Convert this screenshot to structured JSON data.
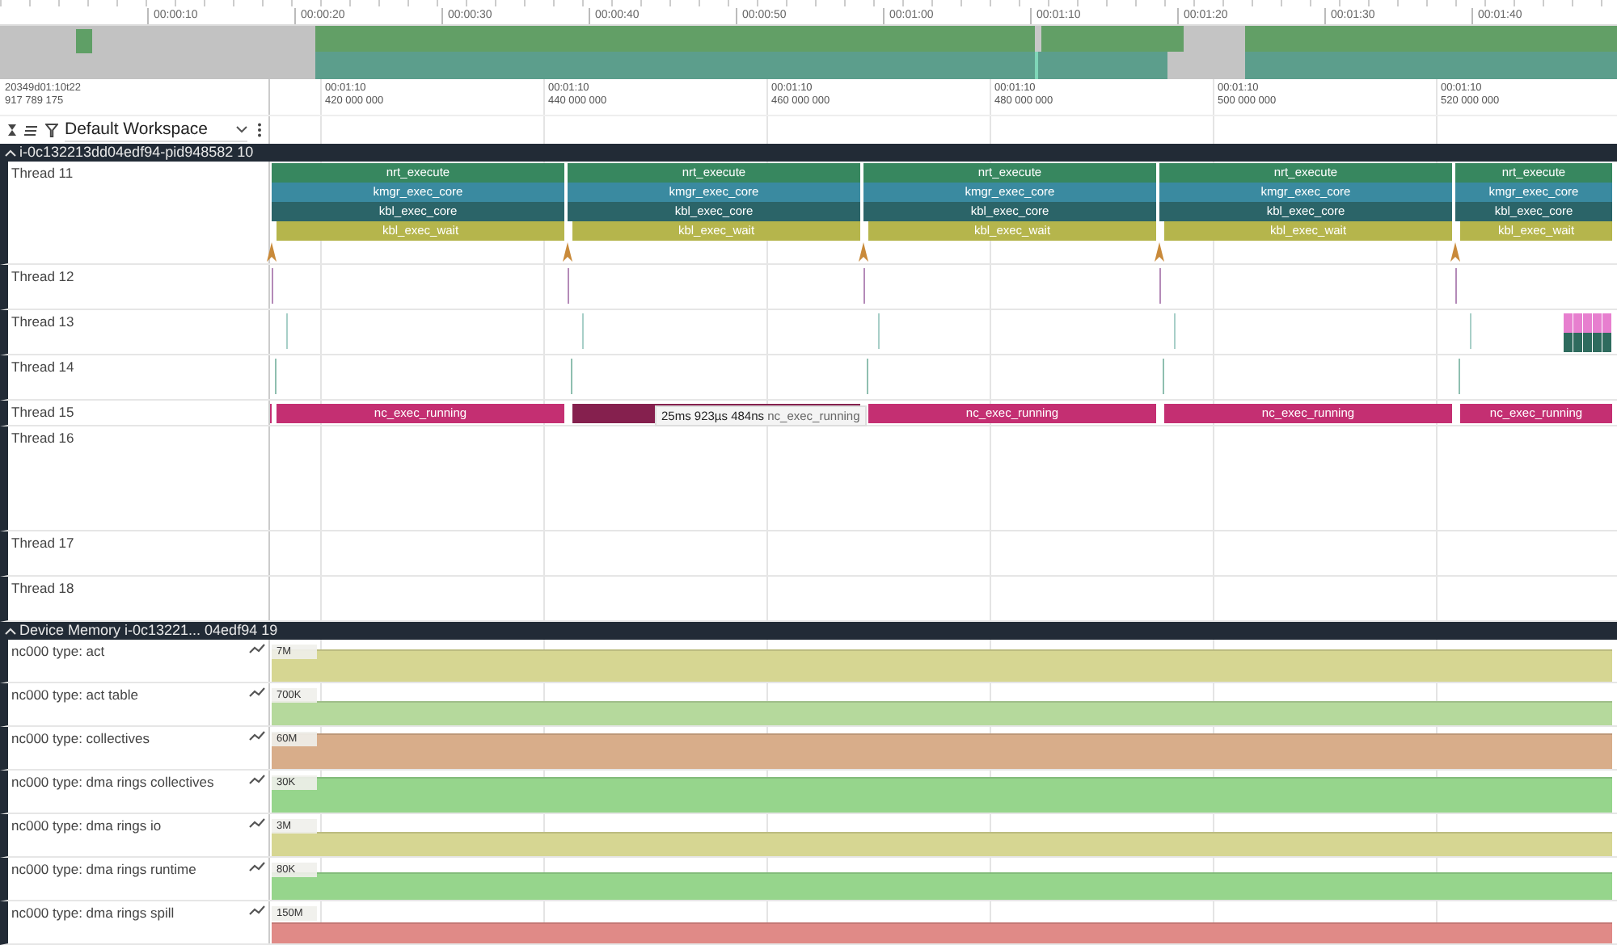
{
  "overview": {
    "ticks": [
      "00:00:10",
      "00:00:20",
      "00:00:30",
      "00:00:40",
      "00:00:50",
      "00:01:00",
      "00:01:10",
      "00:01:20",
      "00:01:30",
      "00:01:40"
    ]
  },
  "time_axis": {
    "origin_date": "20349d01:10t22",
    "origin_offset": "917 789 175",
    "ticks": [
      {
        "time": "00:01:10",
        "offset": "420 000 000"
      },
      {
        "time": "00:01:10",
        "offset": "440 000 000"
      },
      {
        "time": "00:01:10",
        "offset": "460 000 000"
      },
      {
        "time": "00:01:10",
        "offset": "480 000 000"
      },
      {
        "time": "00:01:10",
        "offset": "500 000 000"
      },
      {
        "time": "00:01:10",
        "offset": "520 000 000"
      }
    ]
  },
  "workspace": {
    "name": "Default Workspace"
  },
  "process_group": {
    "title": "i-0c132213dd04edf94-pid948582 10",
    "expanded": true,
    "threads": [
      {
        "name": "Thread 11",
        "kind": "stack",
        "levels": [
          {
            "color": "#37875f",
            "labels": [
              "nrt_execute",
              "nrt_execute",
              "nrt_execute",
              "nrt_execute",
              "nrt_execute"
            ]
          },
          {
            "color": "#3a8aa0",
            "labels": [
              "kmgr_exec_core",
              "kmgr_exec_core",
              "kmgr_exec_core",
              "kmgr_exec_core",
              "kmgr_exec_core"
            ]
          },
          {
            "color": "#2b6468",
            "labels": [
              "kbl_exec_core",
              "kbl_exec_core",
              "kbl_exec_core",
              "kbl_exec_core",
              "kbl_exec_core"
            ]
          },
          {
            "color": "#b5b54c",
            "labels": [
              "kbl_exec_wait",
              "kbl_exec_wait",
              "kbl_exec_wait",
              "kbl_exec_wait",
              "kbl_exec_wait"
            ]
          }
        ]
      },
      {
        "name": "Thread 12",
        "kind": "markers",
        "color": "#b48ab8"
      },
      {
        "name": "Thread 13",
        "kind": "markers",
        "color": "#a8cfc8",
        "burst": [
          {
            "color": "#e77fcf"
          },
          {
            "color": "#2e6b5e"
          }
        ]
      },
      {
        "name": "Thread 14",
        "kind": "markers",
        "color": "#8fbfb0"
      },
      {
        "name": "Thread 15",
        "kind": "slices",
        "color": "#c42f72",
        "slices": [
          {
            "label": "nc_exec_running",
            "selected": false
          },
          {
            "selected": true
          },
          {
            "label": "nc_exec_running",
            "selected": false
          },
          {
            "label": "nc_exec_running",
            "selected": false
          },
          {
            "label": "nc_exec_running",
            "selected": false
          }
        ],
        "tooltip": {
          "duration": "25ms 923µs 484ns",
          "name": "nc_exec_running"
        }
      },
      {
        "name": "Thread 16",
        "kind": "empty"
      },
      {
        "name": "Thread 17",
        "kind": "empty"
      },
      {
        "name": "Thread 18",
        "kind": "empty"
      }
    ]
  },
  "memory_group": {
    "title": "Device Memory i-0c13221... 04edf94 19",
    "expanded": true,
    "counters": [
      {
        "name": "nc000 type: act",
        "scale": "7M",
        "color": "#d6d692"
      },
      {
        "name": "nc000 type: act table",
        "scale": "700K",
        "color": "#b5d99c"
      },
      {
        "name": "nc000 type: collectives",
        "scale": "60M",
        "color": "#d8ad8a"
      },
      {
        "name": "nc000 type: dma rings collectives",
        "scale": "30K",
        "color": "#96d58c"
      },
      {
        "name": "nc000 type: dma rings io",
        "scale": "3M",
        "color": "#d6d692"
      },
      {
        "name": "nc000 type: dma rings runtime",
        "scale": "80K",
        "color": "#96d58c"
      },
      {
        "name": "nc000 type: dma rings spill",
        "scale": "150M",
        "color": "#e08a87"
      }
    ]
  }
}
